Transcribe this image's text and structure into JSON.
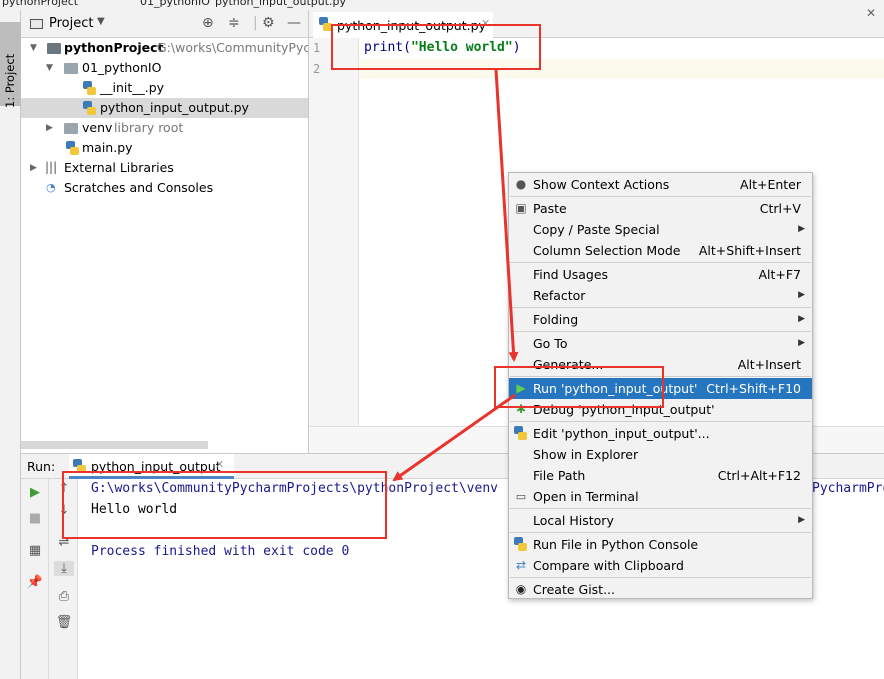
{
  "top_bar": {
    "fragments": [
      "pythonProject",
      "01_pythonIO",
      "python_input_output.py"
    ]
  },
  "left_stripe": {
    "project_tab": "1: Project"
  },
  "project_panel": {
    "title": "Project",
    "tree": [
      {
        "label": "pythonProject",
        "extra": "G:\\works\\CommunityPycha",
        "type": "project-root"
      },
      {
        "label": "01_pythonIO",
        "type": "folder"
      },
      {
        "label": "__init__.py",
        "type": "py-file"
      },
      {
        "label": "python_input_output.py",
        "type": "py-file",
        "selected": true
      },
      {
        "label": "venv",
        "extra": "library root",
        "type": "folder"
      },
      {
        "label": "main.py",
        "type": "py-file"
      },
      {
        "label": "External Libraries",
        "type": "libraries"
      },
      {
        "label": "Scratches and Consoles",
        "type": "scratches"
      }
    ]
  },
  "editor": {
    "tab_label": "python_input_output.py",
    "line_numbers": [
      "1",
      "2"
    ],
    "code": {
      "func": "print(",
      "string": "\"Hello world\"",
      "close": ")"
    }
  },
  "run_panel": {
    "label": "Run:",
    "tab_label": "python_input_output",
    "console": {
      "path_line": "G:\\works\\CommunityPycharmProjects\\pythonProject\\venv",
      "path_tail": "PycharmPro",
      "output_line": "Hello world",
      "exit_line": "Process finished with exit code 0"
    }
  },
  "context_menu": {
    "items": [
      {
        "label": "Show Context Actions",
        "shortcut": "Alt+Enter",
        "icon": "bulb-icon"
      },
      {
        "label": "Paste",
        "shortcut": "Ctrl+V",
        "icon": "clipboard-icon"
      },
      {
        "label": "Copy / Paste Special",
        "submenu": true
      },
      {
        "label": "Column Selection Mode",
        "shortcut": "Alt+Shift+Insert"
      },
      {
        "label": "Find Usages",
        "shortcut": "Alt+F7"
      },
      {
        "label": "Refactor",
        "submenu": true
      },
      {
        "label": "Folding",
        "submenu": true
      },
      {
        "label": "Go To",
        "submenu": true
      },
      {
        "label": "Generate...",
        "shortcut": "Alt+Insert"
      },
      {
        "label": "Run 'python_input_output'",
        "shortcut": "Ctrl+Shift+F10",
        "icon": "run-icon",
        "highlighted": true
      },
      {
        "label": "Debug 'python_input_output'",
        "icon": "debug-icon"
      },
      {
        "label": "Edit 'python_input_output'...",
        "icon": "python-icon"
      },
      {
        "label": "Show in Explorer"
      },
      {
        "label": "File Path",
        "shortcut": "Ctrl+Alt+F12"
      },
      {
        "label": "Open in Terminal",
        "icon": "terminal-icon"
      },
      {
        "label": "Local History",
        "submenu": true
      },
      {
        "label": "Run File in Python Console",
        "icon": "python-icon"
      },
      {
        "label": "Compare with Clipboard",
        "icon": "compare-icon"
      },
      {
        "label": "Create Gist...",
        "icon": "github-icon"
      }
    ]
  },
  "colors": {
    "accent": "#2675bf",
    "annotation_red": "#e8342c",
    "string_green": "#067d17",
    "run_green": "#3f9c35"
  }
}
